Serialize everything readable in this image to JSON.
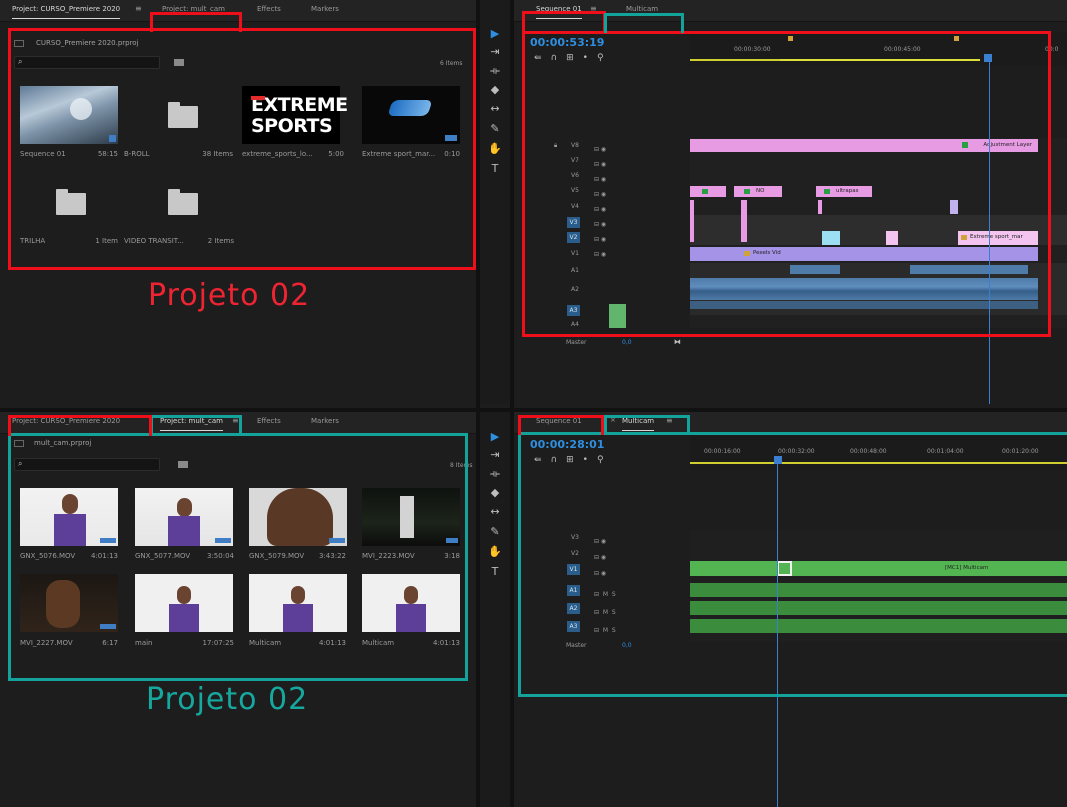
{
  "top_project": {
    "tabs": [
      "Project: CURSO_Premiere 2020",
      "Project: mult_cam",
      "Effects",
      "Markers"
    ],
    "project_file": "CURSO_Premiere 2020.prproj",
    "item_count": "6 Items",
    "items": [
      {
        "name": "Sequence 01",
        "value": "58:15"
      },
      {
        "name": "B-ROLL",
        "value": "38 Items"
      },
      {
        "name": "extreme_sports_lo...",
        "value": "5:00"
      },
      {
        "name": "Extreme sport_mar...",
        "value": "0:10"
      },
      {
        "name": "TRILHA",
        "value": "1 Item"
      },
      {
        "name": "VIDEO TRANSIT...",
        "value": "2 Items"
      }
    ],
    "extreme_logo": [
      "EXTREME",
      "SPORTS"
    ],
    "annotation": "Projeto 02"
  },
  "bottom_project": {
    "tabs": [
      "Project: CURSO_Premiere 2020",
      "Project: mult_cam",
      "Effects",
      "Markers"
    ],
    "project_file": "mult_cam.prproj",
    "item_count": "8 Items",
    "items": [
      {
        "name": "GNX_5076.MOV",
        "value": "4:01:13"
      },
      {
        "name": "GNX_5077.MOV",
        "value": "3:50:04"
      },
      {
        "name": "GNX_5079.MOV",
        "value": "3:43:22"
      },
      {
        "name": "MVI_2223.MOV",
        "value": "3:18"
      },
      {
        "name": "MVI_2227.MOV",
        "value": "6:17"
      },
      {
        "name": "main",
        "value": "17:07:25"
      },
      {
        "name": "Multicam",
        "value": "4:01:13"
      },
      {
        "name": "Multicam",
        "value": "4:01:13"
      }
    ],
    "annotation": "Projeto 02"
  },
  "top_timeline": {
    "tabs": [
      "Sequence 01",
      "Multicam"
    ],
    "timecode": "00:00:53:19",
    "ruler_labels": [
      "00:00:30:00",
      "00:00:45:00",
      "00:0"
    ],
    "video_tracks": [
      "V8",
      "V7",
      "V6",
      "V5",
      "V4",
      "V3",
      "V2",
      "V1"
    ],
    "audio_tracks": [
      "A1",
      "A2",
      "A3",
      "A4"
    ],
    "master_label": "Master",
    "master_value": "0,0",
    "clips": {
      "adjustment": "Adjustment Layer",
      "no": "NO",
      "ultrapas": "ultrapas",
      "extreme_mar": "Extreme sport_mar",
      "pexels": "Pexels Vid"
    },
    "accent_color": "#2e8fe0",
    "clip_color_pink": "#e69be3",
    "clip_color_purple": "#a493e6"
  },
  "bottom_timeline": {
    "tabs": [
      "Sequence 01",
      "Multicam"
    ],
    "timecode": "00:00:28:01",
    "ruler_labels": [
      "00:00:16:00",
      "00:00:32:00",
      "00:00:48:00",
      "00:01:04:00",
      "00:01:20:00"
    ],
    "video_tracks": [
      "V3",
      "V2",
      "V1"
    ],
    "audio_tracks": [
      "A1",
      "A2",
      "A3"
    ],
    "master_label": "Master",
    "master_value": "0,0",
    "clip_label": "[MC1] Multicam",
    "clip_color_green": "#53b552"
  },
  "colors": {
    "highlight_red": "#ef0f1a",
    "highlight_teal": "#13a39a"
  }
}
